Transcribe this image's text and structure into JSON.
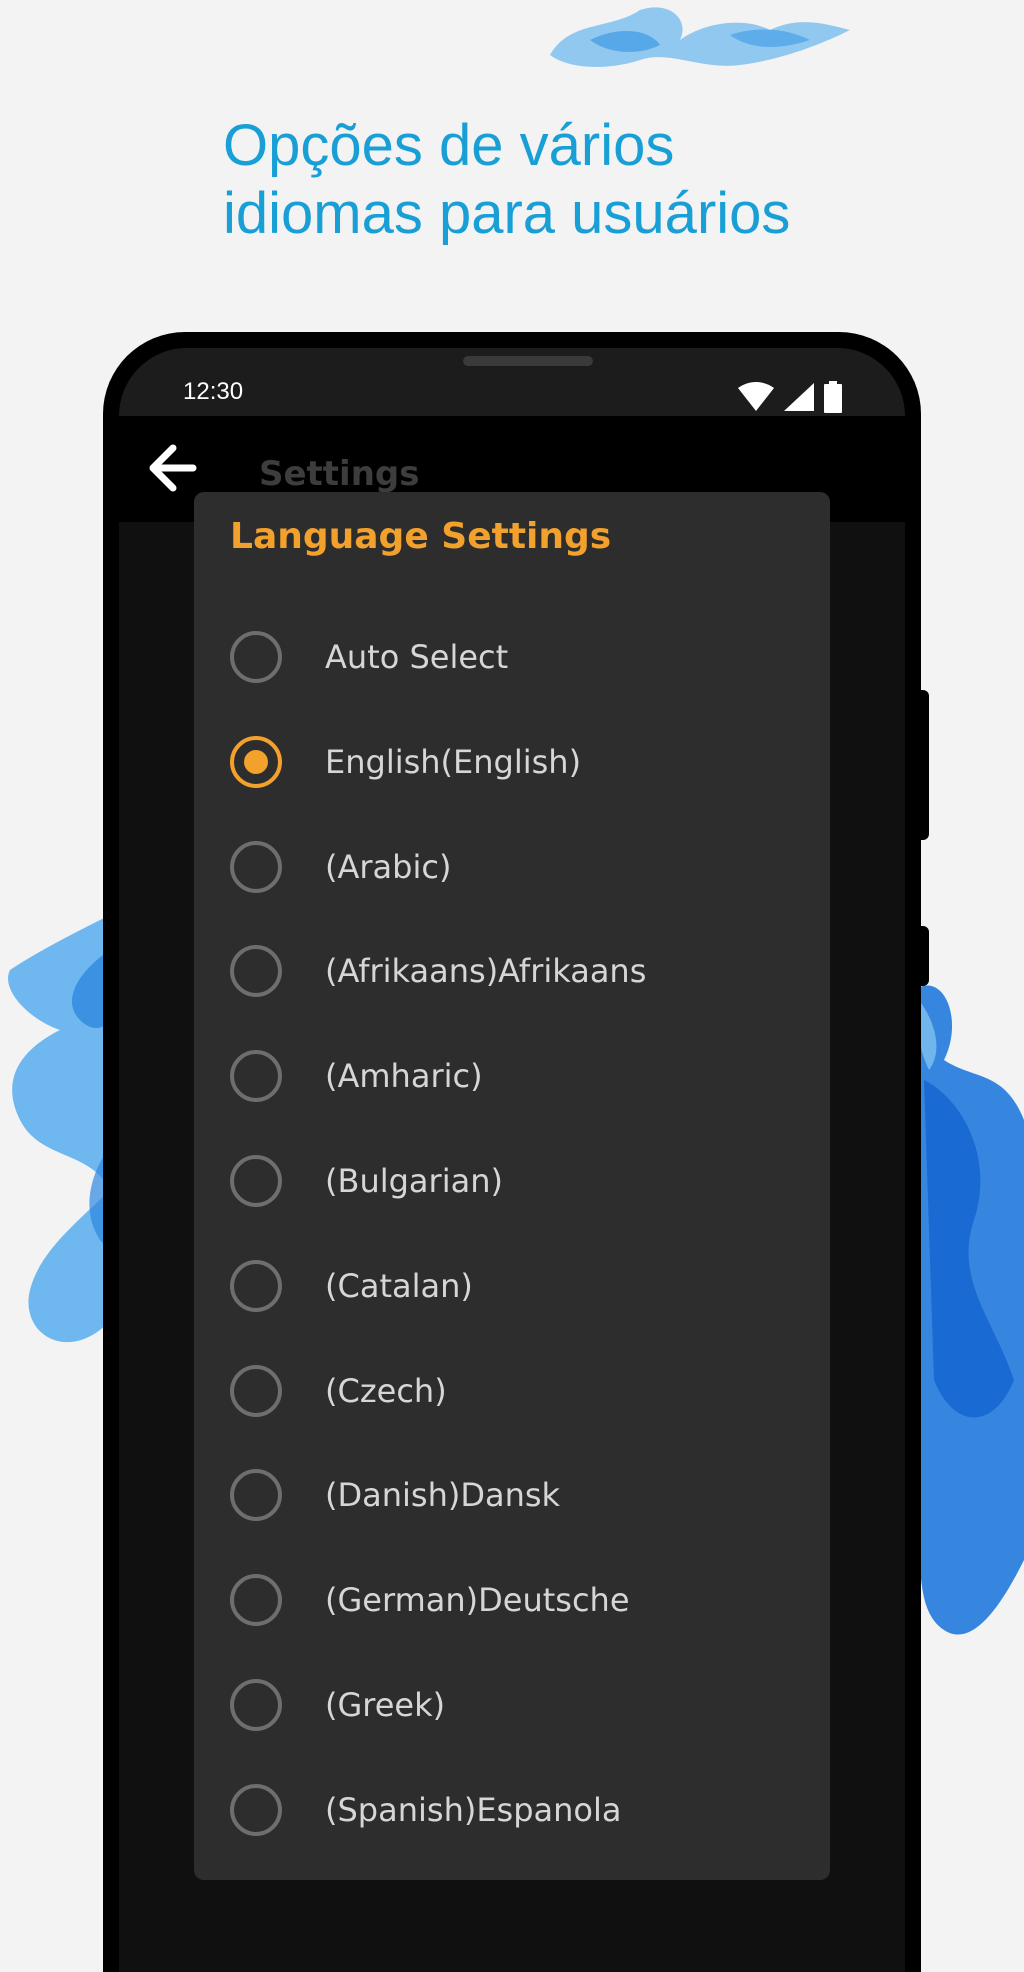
{
  "headline": {
    "line1": "Opções de vários",
    "line2": "idiomas para usuários"
  },
  "statusbar": {
    "time": "12:30",
    "icons": [
      "wifi-icon",
      "cell-signal-icon",
      "battery-icon"
    ]
  },
  "appbar": {
    "back_icon": "arrow-left-icon",
    "title": "Settings"
  },
  "dialog": {
    "title": "Language Settings",
    "selected_index": 1,
    "options": [
      {
        "label": "Auto Select",
        "selected": false
      },
      {
        "label": "English(English)",
        "selected": true
      },
      {
        "label": "(Arabic)",
        "selected": false
      },
      {
        "label": "(Afrikaans)Afrikaans",
        "selected": false
      },
      {
        "label": "(Amharic)",
        "selected": false
      },
      {
        "label": "(Bulgarian)",
        "selected": false
      },
      {
        "label": "(Catalan)",
        "selected": false
      },
      {
        "label": "(Czech)",
        "selected": false
      },
      {
        "label": "(Danish)Dansk",
        "selected": false
      },
      {
        "label": "(German)Deutsche",
        "selected": false
      },
      {
        "label": "(Greek)",
        "selected": false
      },
      {
        "label": "(Spanish)Espanola",
        "selected": false
      }
    ]
  },
  "colors": {
    "headline": "#189fd6",
    "accent": "#f2a12c",
    "dialog_bg": "#2d2d2d",
    "smoke": "#2b8fe0"
  }
}
